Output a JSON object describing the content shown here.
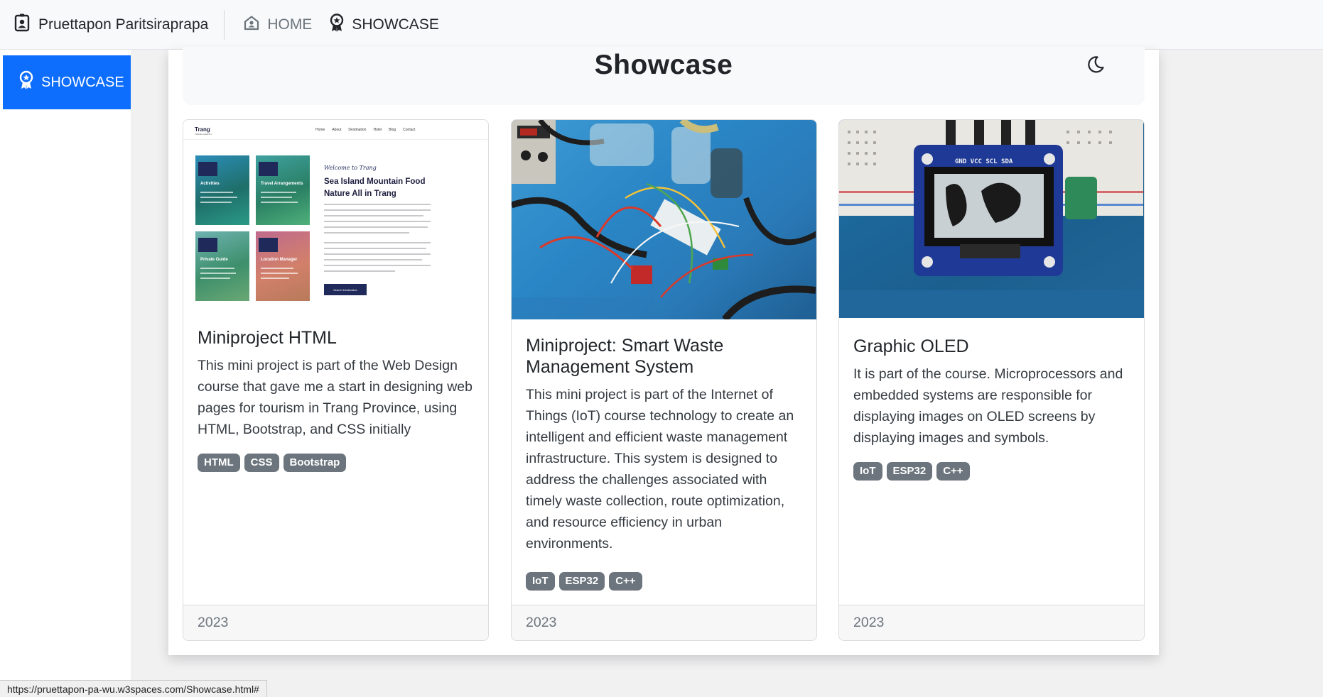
{
  "navbar": {
    "brand_name": "Pruettapon Paritsiraprapa",
    "brand_icon": "id-badge-icon",
    "links": [
      {
        "label": "HOME",
        "icon": "house-user-icon",
        "active": false
      },
      {
        "label": "SHOWCASE",
        "icon": "award-icon",
        "active": true
      }
    ]
  },
  "sidebar": {
    "items": [
      {
        "label": "SHOWCASE",
        "icon": "award-icon",
        "active": true
      }
    ]
  },
  "page": {
    "title": "Showcase",
    "theme_toggle_icon": "moon-icon"
  },
  "cards": [
    {
      "title": "Miniproject HTML",
      "text": "This mini project is part of the Web Design course that gave me a start in designing web pages for tourism in Trang Province, using HTML, Bootstrap, and CSS initially",
      "badges": [
        "HTML",
        "CSS",
        "Bootstrap"
      ],
      "year": "2023",
      "image": "trang-tourism-website-screenshot",
      "thumbnail": {
        "logo": "Trang",
        "logo_sub": "TRAVEL AGENCY",
        "nav": [
          "Home",
          "About",
          "Destination",
          "Hotel",
          "Blog",
          "Contact"
        ],
        "tiles": [
          "Activities",
          "Travel Arrangements",
          "Private Guide",
          "Location Manager"
        ],
        "welcome": "Welcome to Trang",
        "headline": "Sea Island Mountain Food Nature All in Trang",
        "button": "Search Destination"
      }
    },
    {
      "title": "Miniproject: Smart Waste Management System",
      "text": "This mini project is part of the Internet of Things (IoT) course technology to create an intelligent and efficient waste management infrastructure. This system is designed to address the challenges associated with timely waste collection, route optimization, and resource efficiency in urban environments.",
      "badges": [
        "IoT",
        "ESP32",
        "C++"
      ],
      "year": "2023",
      "image": "iot-breadboard-wiring-photo"
    },
    {
      "title": "Graphic OLED",
      "text": "It is part of the course. Microprocessors and embedded systems are responsible for displaying images on OLED screens by displaying images and symbols.",
      "badges": [
        "IoT",
        "ESP32",
        "C++"
      ],
      "year": "2023",
      "image": "oled-display-breadboard-photo",
      "oled_pins": "GND VCC SCL SDA"
    }
  ],
  "status_bar": {
    "url": "https://pruettapon-pa-wu.w3spaces.com/Showcase.html#"
  },
  "colors": {
    "primary": "#0d6efd",
    "badge": "#6c757d",
    "navbar_bg": "#f8f9fa"
  }
}
